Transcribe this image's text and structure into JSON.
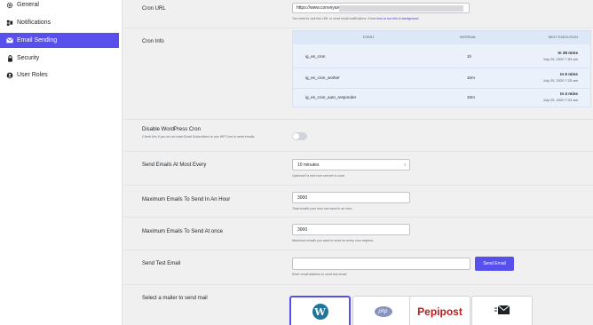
{
  "sidebar": {
    "items": [
      {
        "label": "General",
        "icon": "gear-icon"
      },
      {
        "label": "Notifications",
        "icon": "notifications-icon"
      },
      {
        "label": "Email Sending",
        "icon": "envelope-icon",
        "active": true
      },
      {
        "label": "Security",
        "icon": "lock-icon"
      },
      {
        "label": "User Roles",
        "icon": "users-icon"
      }
    ]
  },
  "cron_url": {
    "label": "Cron URL",
    "value": "https://www.conveyarena.com",
    "help": "You need to visit this URL to send email notifications. Know",
    "help_link": "how to run this in background"
  },
  "cron_info": {
    "label": "Cron Info",
    "headers": [
      "Event",
      "Interval",
      "Next Execution"
    ],
    "rows": [
      {
        "event": "ig_es_cron",
        "interval": "1h",
        "next": "In 35 mins",
        "date": "July 29, 2020 7:53 am"
      },
      {
        "event": "ig_es_cron_worker",
        "interval": "10m",
        "next": "In 6 mins",
        "date": "July 29, 2020 7:25 am"
      },
      {
        "event": "ig_es_cron_auto_responder",
        "interval": "10m",
        "next": "In 4 mins",
        "date": "July 29, 2020 7:23 am"
      }
    ]
  },
  "disable_cron": {
    "label": "Disable WordPress Cron",
    "help": "Check this if you do not want Email Subscribers to use WP Cron to send emails."
  },
  "send_every": {
    "label": "Send Emails At Most Every",
    "value": "10 minutes",
    "help": "Optional if a real cron service is used"
  },
  "max_per_hour": {
    "label": "Maximum Emails To Send In An Hour",
    "value": "3000",
    "help": "Total emails your host can send in an hour."
  },
  "max_at_once": {
    "label": "Maximum Emails To Send At once",
    "value": "3000",
    "help": "Maximum emails you want to send on every cron request."
  },
  "test_email": {
    "label": "Send Test Email",
    "placeholder": "",
    "button": "Send Email",
    "help": "Enter email address to send test email."
  },
  "mailer": {
    "label": "Select a mailer to send mail",
    "options": [
      {
        "name": "WordPress",
        "icon": "wordpress-icon",
        "selected": true
      },
      {
        "name": "php",
        "icon": "php-icon"
      },
      {
        "name": "Pepipost",
        "icon": "pepipost-logo"
      },
      {
        "name": "SMTP",
        "icon": "smtp-envelope-icon"
      }
    ]
  },
  "colors": {
    "accent": "#5850ec",
    "table_bg": "#eaf1fb"
  }
}
